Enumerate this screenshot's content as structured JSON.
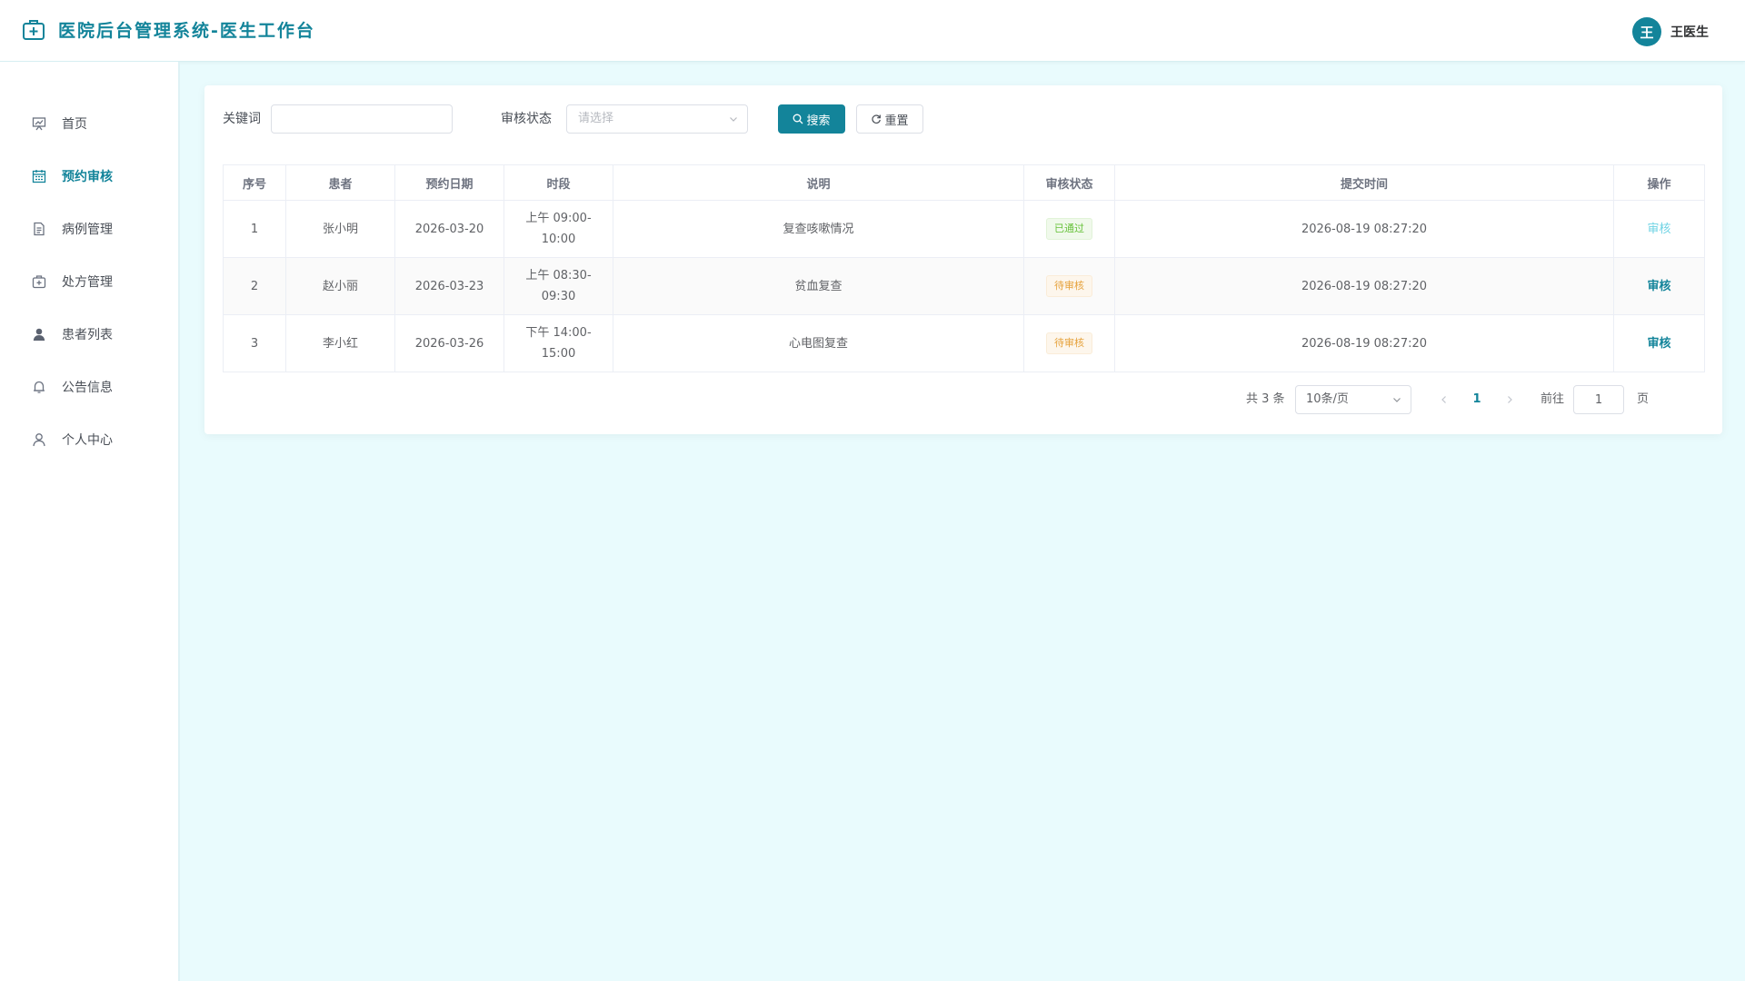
{
  "header": {
    "app_title": "医院后台管理系统-医生工作台",
    "user_avatar_text": "王",
    "user_name": "王医生",
    "brand_color": "#13849a"
  },
  "sidebar": {
    "items": [
      {
        "label": "首页",
        "icon": "chart-board-icon",
        "active": false
      },
      {
        "label": "预约审核",
        "icon": "calendar-icon",
        "active": true
      },
      {
        "label": "病例管理",
        "icon": "document-icon",
        "active": false
      },
      {
        "label": "处方管理",
        "icon": "medical-kit-icon",
        "active": false
      },
      {
        "label": "患者列表",
        "icon": "user-filled-icon",
        "active": false
      },
      {
        "label": "公告信息",
        "icon": "bell-icon",
        "active": false
      },
      {
        "label": "个人中心",
        "icon": "user-outline-icon",
        "active": false
      }
    ]
  },
  "search": {
    "keyword_label": "关键词",
    "keyword_value": "",
    "status_label": "审核状态",
    "status_placeholder": "请选择",
    "search_button": "搜索",
    "reset_button": "重置"
  },
  "table": {
    "headers": [
      "序号",
      "患者",
      "预约日期",
      "时段",
      "说明",
      "审核状态",
      "提交时间",
      "操作"
    ],
    "rows": [
      {
        "index": "1",
        "patient": "张小明",
        "date": "2026-03-20",
        "slot": "上午 09:00-10:00",
        "note": "复查咳嗽情况",
        "status": "已通过",
        "status_type": "success",
        "submitted": "2026-08-19 08:27:20",
        "action": "审核",
        "action_enabled": false
      },
      {
        "index": "2",
        "patient": "赵小丽",
        "date": "2026-03-23",
        "slot": "上午 08:30-09:30",
        "note": "贫血复查",
        "status": "待审核",
        "status_type": "warning",
        "submitted": "2026-08-19 08:27:20",
        "action": "审核",
        "action_enabled": true
      },
      {
        "index": "3",
        "patient": "李小红",
        "date": "2026-03-26",
        "slot": "下午 14:00-15:00",
        "note": "心电图复查",
        "status": "待审核",
        "status_type": "warning",
        "submitted": "2026-08-19 08:27:20",
        "action": "审核",
        "action_enabled": true
      }
    ]
  },
  "pagination": {
    "total_text": "共 3 条",
    "page_size": "10条/页",
    "current_page": "1",
    "goto_label": "前往",
    "goto_value": "1",
    "page_unit": "页"
  }
}
